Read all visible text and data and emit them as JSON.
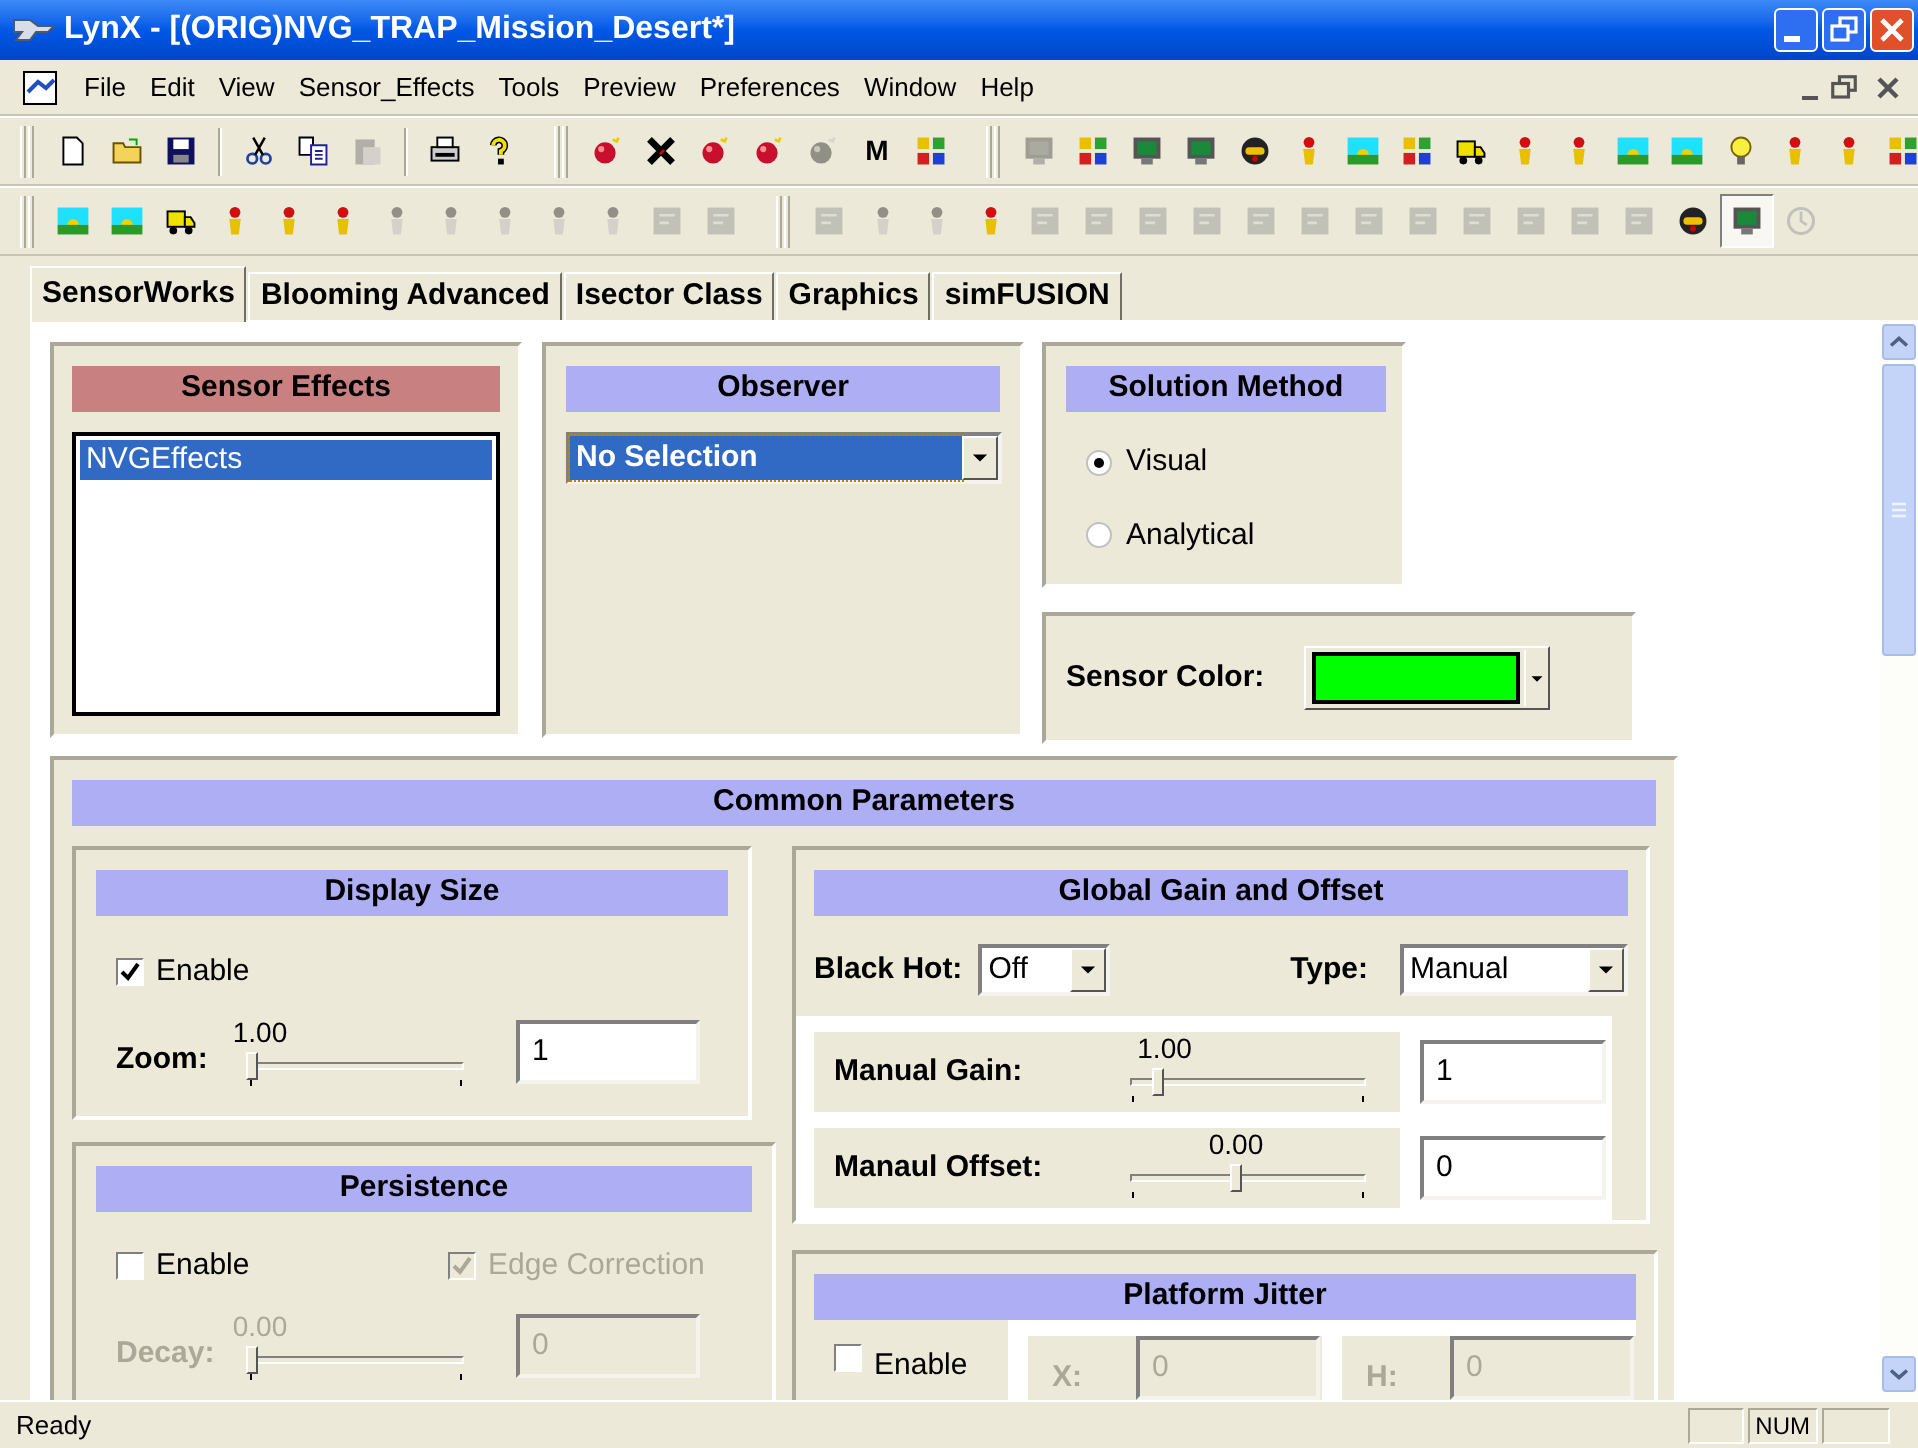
{
  "window": {
    "title": "LynX - [(ORIG)NVG_TRAP_Mission_Desert*]"
  },
  "menu": [
    "File",
    "Edit",
    "View",
    "Sensor_Effects",
    "Tools",
    "Preview",
    "Preferences",
    "Window",
    "Help"
  ],
  "toolbars": [
    {
      "sections": [
        {
          "groups": [
            [
              {
                "disabled": false,
                "pressed": false
              },
              {
                "disabled": false,
                "pressed": false
              },
              {
                "disabled": false,
                "pressed": false
              }
            ],
            [
              {
                "disabled": false,
                "pressed": false
              },
              {
                "disabled": false,
                "pressed": false
              },
              {
                "disabled": true,
                "pressed": false
              }
            ],
            [
              {
                "disabled": false,
                "pressed": false
              },
              {
                "disabled": false,
                "pressed": false
              }
            ]
          ]
        },
        {
          "groups": [
            [
              {
                "disabled": false,
                "pressed": false
              },
              {
                "disabled": false,
                "pressed": false
              },
              {
                "disabled": false,
                "pressed": false
              },
              {
                "disabled": false,
                "pressed": false
              },
              {
                "disabled": true,
                "pressed": false
              },
              {
                "label": "M",
                "disabled": false,
                "pressed": false
              },
              {
                "disabled": false,
                "pressed": false
              }
            ]
          ]
        },
        {
          "groups": [
            [
              {
                "disabled": true,
                "pressed": false
              },
              {
                "disabled": false,
                "pressed": false
              },
              {
                "disabled": false,
                "pressed": false
              },
              {
                "disabled": false,
                "pressed": false
              },
              {
                "disabled": false,
                "pressed": false
              },
              {
                "disabled": false,
                "pressed": false
              },
              {
                "disabled": false,
                "pressed": false
              },
              {
                "disabled": false,
                "pressed": false
              },
              {
                "disabled": false,
                "pressed": false
              },
              {
                "disabled": false,
                "pressed": false
              },
              {
                "disabled": false,
                "pressed": false
              },
              {
                "disabled": false,
                "pressed": false
              },
              {
                "disabled": false,
                "pressed": false
              },
              {
                "disabled": false,
                "pressed": false
              },
              {
                "disabled": false,
                "pressed": false
              },
              {
                "disabled": false,
                "pressed": false
              },
              {
                "disabled": false,
                "pressed": false
              }
            ]
          ]
        }
      ]
    },
    {
      "sections": [
        {
          "groups": [
            [
              {
                "disabled": false,
                "pressed": false
              },
              {
                "disabled": false,
                "pressed": false
              },
              {
                "disabled": false,
                "pressed": false
              },
              {
                "disabled": false,
                "pressed": false
              },
              {
                "disabled": false,
                "pressed": false
              },
              {
                "disabled": false,
                "pressed": false
              },
              {
                "disabled": true,
                "pressed": false
              },
              {
                "disabled": true,
                "pressed": false
              },
              {
                "disabled": true,
                "pressed": false
              },
              {
                "disabled": true,
                "pressed": false
              },
              {
                "disabled": true,
                "pressed": false
              },
              {
                "disabled": true,
                "pressed": false
              },
              {
                "disabled": true,
                "pressed": false
              }
            ]
          ]
        },
        {
          "groups": [
            [
              {
                "disabled": true,
                "pressed": false
              },
              {
                "disabled": true,
                "pressed": false
              },
              {
                "disabled": true,
                "pressed": false
              },
              {
                "disabled": false,
                "pressed": false
              },
              {
                "disabled": true,
                "pressed": false
              },
              {
                "disabled": true,
                "pressed": false
              },
              {
                "disabled": true,
                "pressed": false
              },
              {
                "disabled": true,
                "pressed": false
              },
              {
                "disabled": true,
                "pressed": false
              },
              {
                "disabled": true,
                "pressed": false
              },
              {
                "disabled": true,
                "pressed": false
              },
              {
                "disabled": true,
                "pressed": false
              },
              {
                "disabled": true,
                "pressed": false
              },
              {
                "disabled": true,
                "pressed": false
              },
              {
                "disabled": true,
                "pressed": false
              },
              {
                "disabled": true,
                "pressed": false
              },
              {
                "disabled": false,
                "pressed": false
              },
              {
                "disabled": false,
                "pressed": true
              },
              {
                "disabled": true,
                "pressed": false
              }
            ]
          ]
        }
      ]
    }
  ],
  "tabs": [
    {
      "label": "SensorWorks",
      "selected": true
    },
    {
      "label": "Blooming Advanced",
      "selected": false
    },
    {
      "label": "Isector Class",
      "selected": false
    },
    {
      "label": "Graphics",
      "selected": false
    },
    {
      "label": "simFUSION",
      "selected": false
    }
  ],
  "sensor_effects": {
    "title": "Sensor Effects",
    "items": [
      {
        "label": "NVGEffects",
        "selected": true
      }
    ]
  },
  "observer": {
    "title": "Observer",
    "value": "No Selection",
    "focused": true
  },
  "solution_method": {
    "title": "Solution Method",
    "options": [
      {
        "label": "Visual",
        "selected": true
      },
      {
        "label": "Analytical",
        "selected": false
      }
    ]
  },
  "sensor_color": {
    "label": "Sensor Color:",
    "color": "#00ff00"
  },
  "common_parameters": {
    "title": "Common Parameters",
    "display_size": {
      "title": "Display Size",
      "enable": {
        "label": "Enable",
        "checked": true,
        "disabled": false
      },
      "zoom": {
        "label": "Zoom:",
        "reading": "1.00",
        "level": 0,
        "value": "1",
        "disabled": false
      }
    },
    "persistence": {
      "title": "Persistence",
      "enable": {
        "label": "Enable",
        "checked": false,
        "disabled": false
      },
      "edge_correction": {
        "label": "Edge Correction",
        "checked": true,
        "disabled": true
      },
      "decay": {
        "label": "Decay:",
        "reading": "0.00",
        "level": 0,
        "value": "0",
        "disabled": true
      }
    },
    "global_gain_offset": {
      "title": "Global Gain and Offset",
      "black_hot": {
        "label": "Black Hot:",
        "value": "Off"
      },
      "type": {
        "label": "Type:",
        "value": "Manual"
      },
      "manual_gain": {
        "label": "Manual Gain:",
        "reading": "1.00",
        "level": 0.12,
        "value": "1",
        "disabled": false
      },
      "manual_offset": {
        "label": "Manaul Offset:",
        "reading": "0.00",
        "level": 0.5,
        "value": "0",
        "disabled": false
      }
    },
    "platform_jitter": {
      "title": "Platform Jitter",
      "enable": {
        "label": "Enable",
        "checked": false,
        "disabled": false
      },
      "fields": [
        {
          "label": "X:",
          "value": "0",
          "disabled": true
        },
        {
          "label": "H:",
          "value": "0",
          "disabled": true
        }
      ]
    }
  },
  "status_bar": {
    "text": "Ready",
    "indicators": [
      "NUM"
    ]
  }
}
